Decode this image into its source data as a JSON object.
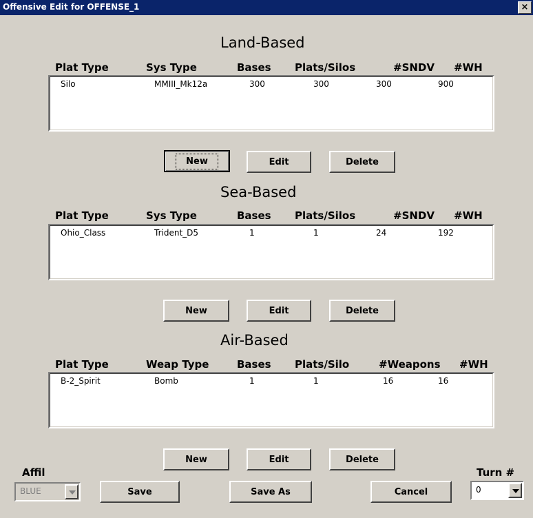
{
  "window": {
    "title": "Offensive Edit for OFFENSE_1",
    "close_label": "×"
  },
  "land": {
    "title": "Land-Based",
    "headers": [
      "Plat Type",
      "Sys Type",
      "Bases",
      "Plats/Silos",
      "#SNDV",
      "#WH"
    ],
    "rows": [
      [
        "Silo",
        "MMIII_Mk12a",
        "300",
        "300",
        "300",
        "900"
      ]
    ],
    "buttons": {
      "new": "New",
      "edit": "Edit",
      "delete": "Delete"
    }
  },
  "sea": {
    "title": "Sea-Based",
    "headers": [
      "Plat Type",
      "Sys Type",
      "Bases",
      "Plats/Silos",
      "#SNDV",
      "#WH"
    ],
    "rows": [
      [
        "Ohio_Class",
        "Trident_D5",
        "1",
        "1",
        "24",
        "192"
      ]
    ],
    "buttons": {
      "new": "New",
      "edit": "Edit",
      "delete": "Delete"
    }
  },
  "air": {
    "title": "Air-Based",
    "headers": [
      "Plat Type",
      "Weap Type",
      "Bases",
      "Plats/Silo",
      "#Weapons",
      "#WH"
    ],
    "rows": [
      [
        "B-2_Spirit",
        "Bomb",
        "1",
        "1",
        "16",
        "16"
      ]
    ],
    "buttons": {
      "new": "New",
      "edit": "Edit",
      "delete": "Delete"
    }
  },
  "footer": {
    "affil_label": "Affil",
    "affil_value": "BLUE",
    "save": "Save",
    "save_as": "Save As",
    "cancel": "Cancel",
    "turn_label": "Turn #",
    "turn_value": "0"
  }
}
